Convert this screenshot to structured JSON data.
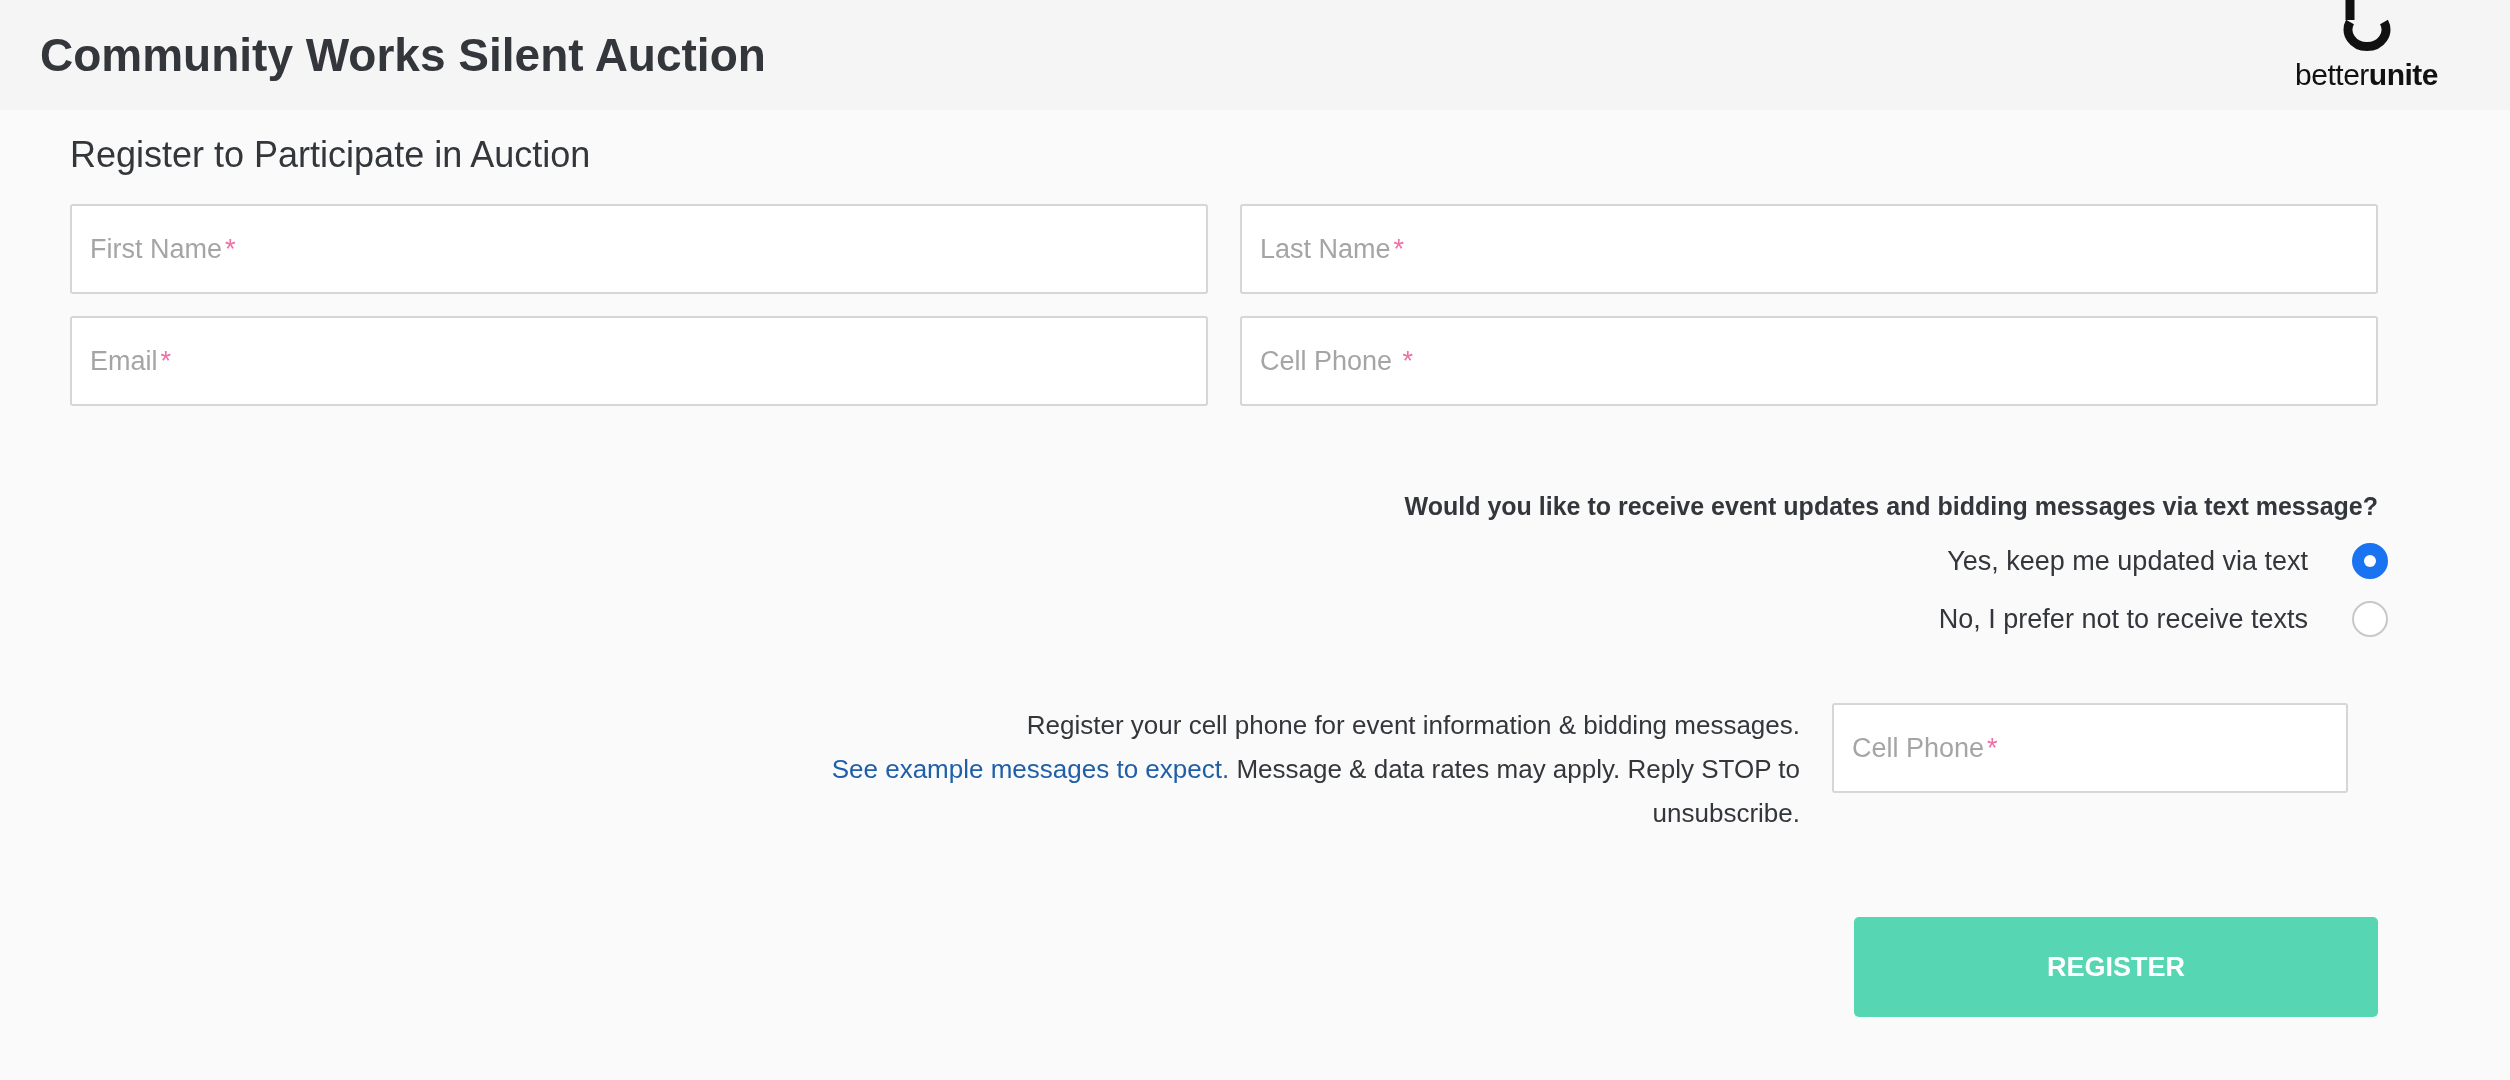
{
  "header": {
    "title": "Community Works Silent Auction",
    "logo_text": "better**unite**"
  },
  "form": {
    "heading": "Register to Participate in Auction",
    "fields": [
      {
        "placeholder": "First Name",
        "required_mark": "*"
      },
      {
        "placeholder": "Last Name",
        "required_mark": "*"
      },
      {
        "placeholder": "Email",
        "required_mark": "*"
      },
      {
        "placeholder": "Cell Phone ",
        "required_mark": "*"
      }
    ],
    "sms_question": "Would you like to receive event updates and bidding messages via text message?",
    "sms_options": [
      {
        "label": "Yes, keep me updated via text",
        "selected": true
      },
      {
        "label": "No, I prefer not to receive texts",
        "selected": false
      }
    ],
    "consent": {
      "before": "Register your cell phone for event information & bidding messages.",
      "link": "See example messages to expect.",
      "after": "Message & data rates may apply. Reply STOP to unsubscribe."
    },
    "phone_field": {
      "placeholder": "Cell Phone",
      "required_mark": "*"
    },
    "submit": "REGISTER"
  }
}
